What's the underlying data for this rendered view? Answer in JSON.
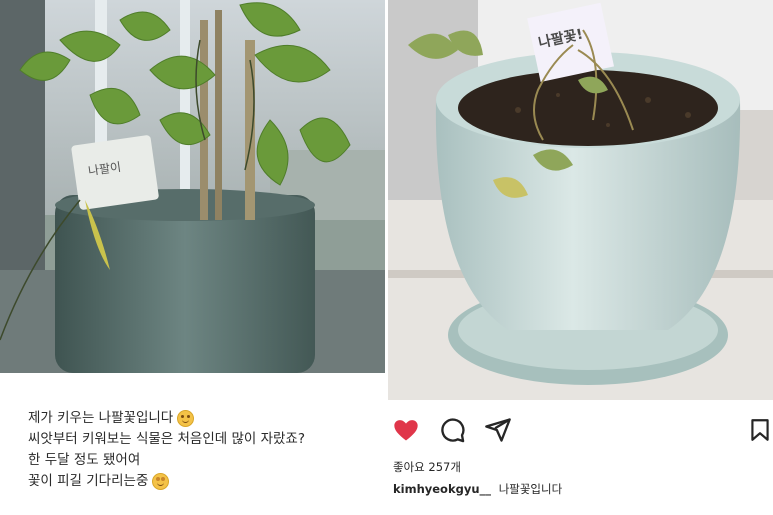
{
  "left_post": {
    "caption_lines": [
      "제가 키우는 나팔꽃입니다",
      "씨앗부터 키워보는 식물은 처음인데 많이 자랐죠?",
      "한 두달 정도 됐어여",
      "꽃이 피길 기다리는중"
    ],
    "plant_tag_text": "나팔이"
  },
  "right_post": {
    "plant_tag_text": "나팔꽃!",
    "likes_text": "좋아요 257개",
    "username": "kimhyeokgyu__",
    "caption": "나팔꽃입니다",
    "icons": [
      "heart-icon",
      "comment-icon",
      "share-icon",
      "bookmark-icon"
    ],
    "accent_color": "#e0364a"
  }
}
